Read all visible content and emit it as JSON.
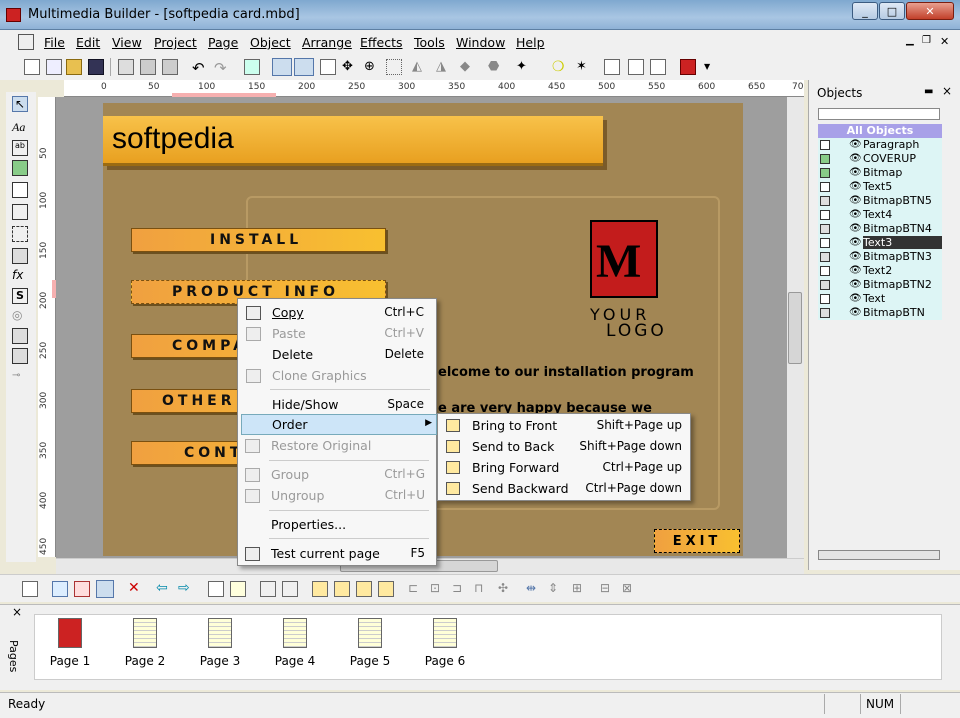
{
  "window": {
    "title": "Multimedia Builder - [softpedia card.mbd]",
    "min": "_",
    "max": "□",
    "close": "✕"
  },
  "menu": [
    "File",
    "Edit",
    "View",
    "Project",
    "Page",
    "Object",
    "Arrange",
    "Effects",
    "Tools",
    "Window",
    "Help"
  ],
  "ruler": {
    "h": [
      "0",
      "50",
      "100",
      "150",
      "200",
      "250",
      "300",
      "350",
      "400",
      "450",
      "500",
      "550",
      "600",
      "650",
      "70"
    ],
    "v": [
      "50",
      "100",
      "150",
      "200",
      "250",
      "300",
      "350",
      "400",
      "450"
    ]
  },
  "canvas": {
    "banner": "softpedia",
    "buttons": [
      "INSTALL",
      "PRODUCT INFO",
      "COMPA",
      "OTHER",
      "CONT"
    ],
    "logo_letter": "M",
    "logo_top": "YOUR",
    "logo_bottom": "LOGO",
    "welcome": "elcome to our installation program",
    "happy": "e are very happy because we",
    "exit": "EXIT"
  },
  "objects_panel": {
    "title": "Objects",
    "all": "All Objects",
    "items": [
      "Paragraph",
      "COVERUP",
      "Bitmap",
      "Text5",
      "BitmapBTN5",
      "Text4",
      "BitmapBTN4",
      "Text3",
      "BitmapBTN3",
      "Text2",
      "BitmapBTN2",
      "Text",
      "BitmapBTN"
    ],
    "selected": "Text3"
  },
  "context_menu": {
    "items": [
      {
        "label": "Copy",
        "shortcut": "Ctrl+C",
        "enabled": true
      },
      {
        "label": "Paste",
        "shortcut": "Ctrl+V",
        "enabled": false
      },
      {
        "label": "Delete",
        "shortcut": "Delete",
        "enabled": true
      },
      {
        "label": "Clone Graphics",
        "shortcut": "",
        "enabled": false
      },
      {
        "label": "Hide/Show",
        "shortcut": "Space",
        "enabled": true
      },
      {
        "label": "Order",
        "shortcut": "",
        "enabled": true
      },
      {
        "label": "Restore Original",
        "shortcut": "",
        "enabled": false
      },
      {
        "label": "Group",
        "shortcut": "Ctrl+G",
        "enabled": false
      },
      {
        "label": "Ungroup",
        "shortcut": "Ctrl+U",
        "enabled": false
      },
      {
        "label": "Properties...",
        "shortcut": "",
        "enabled": true
      },
      {
        "label": "Test current page",
        "shortcut": "F5",
        "enabled": true
      }
    ],
    "order_submenu": [
      {
        "label": "Bring to Front",
        "shortcut": "Shift+Page up"
      },
      {
        "label": "Send to Back",
        "shortcut": "Shift+Page down"
      },
      {
        "label": "Bring Forward",
        "shortcut": "Ctrl+Page up"
      },
      {
        "label": "Send Backward",
        "shortcut": "Ctrl+Page down"
      }
    ]
  },
  "pages_panel": {
    "label": "Pages",
    "close": "×",
    "pages": [
      "Page 1",
      "Page 2",
      "Page 3",
      "Page 4",
      "Page 5",
      "Page 6"
    ]
  },
  "status": {
    "text": "Ready",
    "num": "NUM"
  },
  "colors": {
    "accent": "#cde5f8",
    "page_bg": "#a28654",
    "button": "#f0a040",
    "logo": "#c31c1c"
  }
}
